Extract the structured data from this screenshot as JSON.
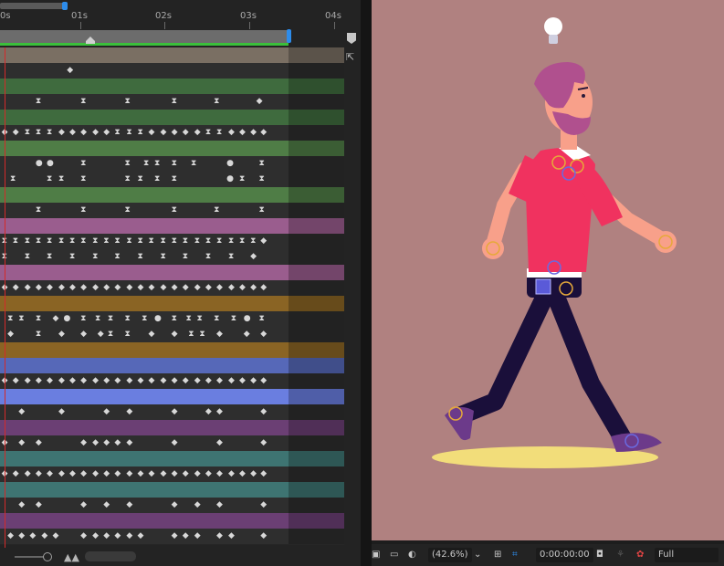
{
  "ruler": {
    "labels": [
      "0s",
      "01s",
      "02s",
      "03s",
      "04s"
    ]
  },
  "viewer_bar": {
    "zoom_label": "(42.6%)",
    "timecode": "0:00:00:00",
    "resolution": "Full"
  },
  "icons": {
    "marker": "marker-icon",
    "pin": "pin-icon",
    "zoom": "zoom-slider-icon",
    "mountain": "mountain-icon",
    "snapshot": "camera-icon",
    "channels": "channels-icon",
    "mask": "mask-icon",
    "monitor": "monitor-icon",
    "region": "region-of-interest-icon",
    "grid": "grid-icon"
  },
  "colors": {
    "tan": "#7a6f63",
    "green": "#3f6b3e",
    "green_bright": "#4f7d46",
    "pink": "#9a5d8e",
    "orange": "#8a6424",
    "blue": "#5668b8",
    "blue_bright": "#6a7ee0",
    "purple": "#6b3f74",
    "teal": "#3e7472",
    "gray_row": "#2e2e2e",
    "viewer_bg": "#b08180",
    "shirt": "#f0325f",
    "skin": "#f8a08a",
    "hair": "#b0508e",
    "pants": "#1a0f3a",
    "shadow": "#f2dd7a",
    "shoe": "#6c3a8a"
  },
  "tracks": [
    {
      "color": "tan",
      "kind": "bar"
    },
    {
      "color": "gray_row",
      "keys": [
        {
          "t": 0.82,
          "s": "◆"
        }
      ]
    },
    {
      "color": "green",
      "kind": "bar"
    },
    {
      "color": "gray_row",
      "keys": [
        {
          "t": 0.45,
          "s": "⧗"
        },
        {
          "t": 0.98,
          "s": "⧗"
        },
        {
          "t": 1.5,
          "s": "⧗"
        },
        {
          "t": 2.05,
          "s": "⧗"
        },
        {
          "t": 2.55,
          "s": "⧗"
        },
        {
          "t": 3.05,
          "s": "◆"
        }
      ]
    },
    {
      "color": "green",
      "kind": "bar"
    },
    {
      "color": "gray_row",
      "keys": [
        {
          "t": 0.05,
          "s": "◆"
        },
        {
          "t": 0.18,
          "s": "◆"
        },
        {
          "t": 0.32,
          "s": "⧗"
        },
        {
          "t": 0.45,
          "s": "⧗"
        },
        {
          "t": 0.58,
          "s": "⧗"
        },
        {
          "t": 0.72,
          "s": "◆"
        },
        {
          "t": 0.85,
          "s": "◆"
        },
        {
          "t": 0.98,
          "s": "◆"
        },
        {
          "t": 1.12,
          "s": "◆"
        },
        {
          "t": 1.25,
          "s": "◆"
        },
        {
          "t": 1.38,
          "s": "⧗"
        },
        {
          "t": 1.52,
          "s": "⧗"
        },
        {
          "t": 1.65,
          "s": "⧗"
        },
        {
          "t": 1.78,
          "s": "◆"
        },
        {
          "t": 1.92,
          "s": "◆"
        },
        {
          "t": 2.05,
          "s": "◆"
        },
        {
          "t": 2.18,
          "s": "◆"
        },
        {
          "t": 2.32,
          "s": "◆"
        },
        {
          "t": 2.45,
          "s": "⧗"
        },
        {
          "t": 2.58,
          "s": "⧗"
        },
        {
          "t": 2.72,
          "s": "◆"
        },
        {
          "t": 2.85,
          "s": "◆"
        },
        {
          "t": 2.98,
          "s": "◆"
        },
        {
          "t": 3.1,
          "s": "◆"
        }
      ]
    },
    {
      "color": "green_bright",
      "kind": "bar"
    },
    {
      "color": "gray_row",
      "keys": [
        {
          "t": 0.45,
          "s": "●"
        },
        {
          "t": 0.58,
          "s": "●"
        },
        {
          "t": 0.98,
          "s": "⧗"
        },
        {
          "t": 1.5,
          "s": "⧗"
        },
        {
          "t": 1.72,
          "s": "⧗"
        },
        {
          "t": 1.85,
          "s": "⧗"
        },
        {
          "t": 2.05,
          "s": "⧗"
        },
        {
          "t": 2.28,
          "s": "⧗"
        },
        {
          "t": 2.7,
          "s": "●"
        },
        {
          "t": 3.08,
          "s": "⧗"
        }
      ]
    },
    {
      "color": "gray_row",
      "keys": [
        {
          "t": 0.15,
          "s": "⧗"
        },
        {
          "t": 0.58,
          "s": "⧗"
        },
        {
          "t": 0.72,
          "s": "⧗"
        },
        {
          "t": 0.98,
          "s": "⧗"
        },
        {
          "t": 1.5,
          "s": "⧗"
        },
        {
          "t": 1.65,
          "s": "⧗"
        },
        {
          "t": 1.85,
          "s": "⧗"
        },
        {
          "t": 2.05,
          "s": "⧗"
        },
        {
          "t": 2.7,
          "s": "●"
        },
        {
          "t": 2.85,
          "s": "⧗"
        },
        {
          "t": 3.08,
          "s": "⧗"
        }
      ]
    },
    {
      "color": "green_bright",
      "kind": "bar"
    },
    {
      "color": "gray_row",
      "keys": [
        {
          "t": 0.45,
          "s": "⧗"
        },
        {
          "t": 0.98,
          "s": "⧗"
        },
        {
          "t": 1.5,
          "s": "⧗"
        },
        {
          "t": 2.05,
          "s": "⧗"
        },
        {
          "t": 2.55,
          "s": "⧗"
        },
        {
          "t": 3.08,
          "s": "⧗"
        }
      ]
    },
    {
      "color": "pink",
      "kind": "bar"
    },
    {
      "color": "gray_row",
      "keys": [
        {
          "t": 0.05,
          "s": "⧗"
        },
        {
          "t": 0.18,
          "s": "⧗"
        },
        {
          "t": 0.32,
          "s": "⧗"
        },
        {
          "t": 0.45,
          "s": "⧗"
        },
        {
          "t": 0.58,
          "s": "⧗"
        },
        {
          "t": 0.72,
          "s": "⧗"
        },
        {
          "t": 0.85,
          "s": "⧗"
        },
        {
          "t": 0.98,
          "s": "⧗"
        },
        {
          "t": 1.12,
          "s": "⧗"
        },
        {
          "t": 1.25,
          "s": "⧗"
        },
        {
          "t": 1.38,
          "s": "⧗"
        },
        {
          "t": 1.52,
          "s": "⧗"
        },
        {
          "t": 1.65,
          "s": "⧗"
        },
        {
          "t": 1.78,
          "s": "⧗"
        },
        {
          "t": 1.92,
          "s": "⧗"
        },
        {
          "t": 2.05,
          "s": "⧗"
        },
        {
          "t": 2.18,
          "s": "⧗"
        },
        {
          "t": 2.32,
          "s": "⧗"
        },
        {
          "t": 2.45,
          "s": "⧗"
        },
        {
          "t": 2.58,
          "s": "⧗"
        },
        {
          "t": 2.72,
          "s": "⧗"
        },
        {
          "t": 2.85,
          "s": "⧗"
        },
        {
          "t": 2.98,
          "s": "⧗"
        },
        {
          "t": 3.1,
          "s": "◆"
        }
      ]
    },
    {
      "color": "gray_row",
      "keys": [
        {
          "t": 0.05,
          "s": "⧗"
        },
        {
          "t": 0.32,
          "s": "⧗"
        },
        {
          "t": 0.58,
          "s": "⧗"
        },
        {
          "t": 0.85,
          "s": "⧗"
        },
        {
          "t": 1.12,
          "s": "⧗"
        },
        {
          "t": 1.38,
          "s": "⧗"
        },
        {
          "t": 1.65,
          "s": "⧗"
        },
        {
          "t": 1.92,
          "s": "⧗"
        },
        {
          "t": 2.18,
          "s": "⧗"
        },
        {
          "t": 2.45,
          "s": "⧗"
        },
        {
          "t": 2.72,
          "s": "⧗"
        },
        {
          "t": 2.98,
          "s": "◆"
        }
      ]
    },
    {
      "color": "pink",
      "kind": "bar"
    },
    {
      "color": "gray_row",
      "keys": [
        {
          "t": 0.05,
          "s": "◆"
        },
        {
          "t": 0.18,
          "s": "◆"
        },
        {
          "t": 0.32,
          "s": "◆"
        },
        {
          "t": 0.45,
          "s": "◆"
        },
        {
          "t": 0.58,
          "s": "◆"
        },
        {
          "t": 0.72,
          "s": "◆"
        },
        {
          "t": 0.85,
          "s": "◆"
        },
        {
          "t": 0.98,
          "s": "◆"
        },
        {
          "t": 1.12,
          "s": "◆"
        },
        {
          "t": 1.25,
          "s": "◆"
        },
        {
          "t": 1.38,
          "s": "◆"
        },
        {
          "t": 1.52,
          "s": "◆"
        },
        {
          "t": 1.65,
          "s": "◆"
        },
        {
          "t": 1.78,
          "s": "◆"
        },
        {
          "t": 1.92,
          "s": "◆"
        },
        {
          "t": 2.05,
          "s": "◆"
        },
        {
          "t": 2.18,
          "s": "◆"
        },
        {
          "t": 2.32,
          "s": "◆"
        },
        {
          "t": 2.45,
          "s": "◆"
        },
        {
          "t": 2.58,
          "s": "◆"
        },
        {
          "t": 2.72,
          "s": "◆"
        },
        {
          "t": 2.85,
          "s": "◆"
        },
        {
          "t": 2.98,
          "s": "◆"
        },
        {
          "t": 3.1,
          "s": "◆"
        }
      ]
    },
    {
      "color": "orange",
      "kind": "bar"
    },
    {
      "color": "gray_row",
      "keys": [
        {
          "t": 0.12,
          "s": "⧗"
        },
        {
          "t": 0.25,
          "s": "⧗"
        },
        {
          "t": 0.45,
          "s": "⧗"
        },
        {
          "t": 0.65,
          "s": "◆"
        },
        {
          "t": 0.78,
          "s": "●"
        },
        {
          "t": 0.98,
          "s": "⧗"
        },
        {
          "t": 1.15,
          "s": "⧗"
        },
        {
          "t": 1.3,
          "s": "⧗"
        },
        {
          "t": 1.5,
          "s": "⧗"
        },
        {
          "t": 1.7,
          "s": "⧗"
        },
        {
          "t": 1.85,
          "s": "●"
        },
        {
          "t": 2.05,
          "s": "⧗"
        },
        {
          "t": 2.22,
          "s": "⧗"
        },
        {
          "t": 2.35,
          "s": "⧗"
        },
        {
          "t": 2.55,
          "s": "⧗"
        },
        {
          "t": 2.75,
          "s": "⧗"
        },
        {
          "t": 2.9,
          "s": "●"
        },
        {
          "t": 3.08,
          "s": "⧗"
        }
      ]
    },
    {
      "color": "gray_row",
      "keys": [
        {
          "t": 0.12,
          "s": "◆"
        },
        {
          "t": 0.45,
          "s": "⧗"
        },
        {
          "t": 0.72,
          "s": "◆"
        },
        {
          "t": 0.98,
          "s": "◆"
        },
        {
          "t": 1.18,
          "s": "◆"
        },
        {
          "t": 1.3,
          "s": "⧗"
        },
        {
          "t": 1.5,
          "s": "⧗"
        },
        {
          "t": 1.78,
          "s": "◆"
        },
        {
          "t": 2.05,
          "s": "◆"
        },
        {
          "t": 2.25,
          "s": "⧗"
        },
        {
          "t": 2.38,
          "s": "⧗"
        },
        {
          "t": 2.58,
          "s": "◆"
        },
        {
          "t": 2.9,
          "s": "◆"
        },
        {
          "t": 3.1,
          "s": "◆"
        }
      ]
    },
    {
      "color": "orange",
      "kind": "bar"
    },
    {
      "color": "blue",
      "kind": "bar"
    },
    {
      "color": "gray_row",
      "keys": [
        {
          "t": 0.05,
          "s": "◆"
        },
        {
          "t": 0.18,
          "s": "◆"
        },
        {
          "t": 0.32,
          "s": "◆"
        },
        {
          "t": 0.45,
          "s": "◆"
        },
        {
          "t": 0.58,
          "s": "◆"
        },
        {
          "t": 0.72,
          "s": "◆"
        },
        {
          "t": 0.85,
          "s": "◆"
        },
        {
          "t": 0.98,
          "s": "◆"
        },
        {
          "t": 1.12,
          "s": "◆"
        },
        {
          "t": 1.25,
          "s": "◆"
        },
        {
          "t": 1.38,
          "s": "◆"
        },
        {
          "t": 1.52,
          "s": "◆"
        },
        {
          "t": 1.65,
          "s": "◆"
        },
        {
          "t": 1.78,
          "s": "◆"
        },
        {
          "t": 1.92,
          "s": "◆"
        },
        {
          "t": 2.05,
          "s": "◆"
        },
        {
          "t": 2.18,
          "s": "◆"
        },
        {
          "t": 2.32,
          "s": "◆"
        },
        {
          "t": 2.45,
          "s": "◆"
        },
        {
          "t": 2.58,
          "s": "◆"
        },
        {
          "t": 2.72,
          "s": "◆"
        },
        {
          "t": 2.85,
          "s": "◆"
        },
        {
          "t": 2.98,
          "s": "◆"
        },
        {
          "t": 3.1,
          "s": "◆"
        }
      ]
    },
    {
      "color": "blue_bright",
      "kind": "bar"
    },
    {
      "color": "gray_row",
      "keys": [
        {
          "t": 0.25,
          "s": "◆"
        },
        {
          "t": 0.72,
          "s": "◆"
        },
        {
          "t": 1.25,
          "s": "◆"
        },
        {
          "t": 1.52,
          "s": "◆"
        },
        {
          "t": 2.05,
          "s": "◆"
        },
        {
          "t": 2.45,
          "s": "◆"
        },
        {
          "t": 2.58,
          "s": "◆"
        },
        {
          "t": 3.1,
          "s": "◆"
        }
      ]
    },
    {
      "color": "purple",
      "kind": "bar"
    },
    {
      "color": "gray_row",
      "keys": [
        {
          "t": 0.05,
          "s": "◆"
        },
        {
          "t": 0.25,
          "s": "◆"
        },
        {
          "t": 0.45,
          "s": "◆"
        },
        {
          "t": 0.98,
          "s": "◆"
        },
        {
          "t": 1.12,
          "s": "◆"
        },
        {
          "t": 1.25,
          "s": "◆"
        },
        {
          "t": 1.38,
          "s": "◆"
        },
        {
          "t": 1.52,
          "s": "◆"
        },
        {
          "t": 2.05,
          "s": "◆"
        },
        {
          "t": 2.58,
          "s": "◆"
        },
        {
          "t": 3.1,
          "s": "◆"
        }
      ]
    },
    {
      "color": "teal",
      "kind": "bar"
    },
    {
      "color": "gray_row",
      "keys": [
        {
          "t": 0.05,
          "s": "◆"
        },
        {
          "t": 0.18,
          "s": "◆"
        },
        {
          "t": 0.32,
          "s": "◆"
        },
        {
          "t": 0.45,
          "s": "◆"
        },
        {
          "t": 0.58,
          "s": "◆"
        },
        {
          "t": 0.72,
          "s": "◆"
        },
        {
          "t": 0.85,
          "s": "◆"
        },
        {
          "t": 0.98,
          "s": "◆"
        },
        {
          "t": 1.12,
          "s": "◆"
        },
        {
          "t": 1.25,
          "s": "◆"
        },
        {
          "t": 1.38,
          "s": "◆"
        },
        {
          "t": 1.52,
          "s": "◆"
        },
        {
          "t": 1.65,
          "s": "◆"
        },
        {
          "t": 1.78,
          "s": "◆"
        },
        {
          "t": 1.92,
          "s": "◆"
        },
        {
          "t": 2.05,
          "s": "◆"
        },
        {
          "t": 2.18,
          "s": "◆"
        },
        {
          "t": 2.32,
          "s": "◆"
        },
        {
          "t": 2.45,
          "s": "◆"
        },
        {
          "t": 2.58,
          "s": "◆"
        },
        {
          "t": 2.72,
          "s": "◆"
        },
        {
          "t": 2.85,
          "s": "◆"
        },
        {
          "t": 2.98,
          "s": "◆"
        },
        {
          "t": 3.1,
          "s": "◆"
        }
      ]
    },
    {
      "color": "teal",
      "kind": "bar"
    },
    {
      "color": "gray_row",
      "keys": [
        {
          "t": 0.25,
          "s": "◆"
        },
        {
          "t": 0.45,
          "s": "◆"
        },
        {
          "t": 0.98,
          "s": "◆"
        },
        {
          "t": 1.25,
          "s": "◆"
        },
        {
          "t": 1.52,
          "s": "◆"
        },
        {
          "t": 2.05,
          "s": "◆"
        },
        {
          "t": 2.32,
          "s": "◆"
        },
        {
          "t": 2.58,
          "s": "◆"
        },
        {
          "t": 3.1,
          "s": "◆"
        }
      ]
    },
    {
      "color": "purple",
      "kind": "bar"
    },
    {
      "color": "gray_row",
      "keys": [
        {
          "t": 0.12,
          "s": "◆"
        },
        {
          "t": 0.25,
          "s": "◆"
        },
        {
          "t": 0.38,
          "s": "◆"
        },
        {
          "t": 0.52,
          "s": "◆"
        },
        {
          "t": 0.65,
          "s": "◆"
        },
        {
          "t": 0.98,
          "s": "◆"
        },
        {
          "t": 1.12,
          "s": "◆"
        },
        {
          "t": 1.25,
          "s": "◆"
        },
        {
          "t": 1.38,
          "s": "◆"
        },
        {
          "t": 1.52,
          "s": "◆"
        },
        {
          "t": 1.65,
          "s": "◆"
        },
        {
          "t": 2.05,
          "s": "◆"
        },
        {
          "t": 2.18,
          "s": "◆"
        },
        {
          "t": 2.32,
          "s": "◆"
        },
        {
          "t": 2.58,
          "s": "◆"
        },
        {
          "t": 2.72,
          "s": "◆"
        },
        {
          "t": 3.1,
          "s": "◆"
        }
      ]
    }
  ]
}
